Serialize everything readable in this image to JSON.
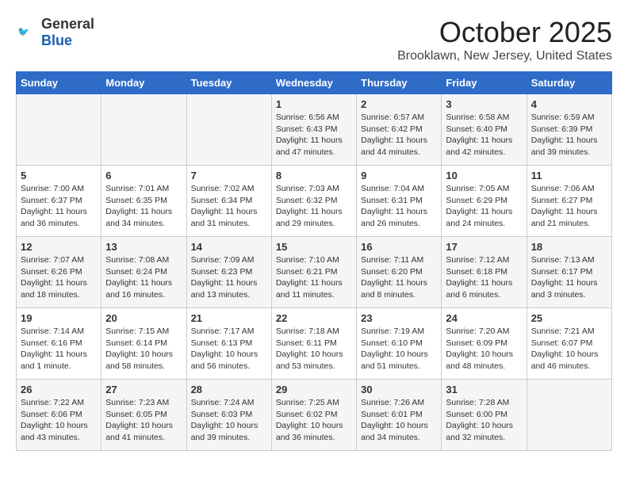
{
  "header": {
    "logo_general": "General",
    "logo_blue": "Blue",
    "month_title": "October 2025",
    "location": "Brooklawn, New Jersey, United States"
  },
  "days_of_week": [
    "Sunday",
    "Monday",
    "Tuesday",
    "Wednesday",
    "Thursday",
    "Friday",
    "Saturday"
  ],
  "weeks": [
    [
      {
        "day": "",
        "info": ""
      },
      {
        "day": "",
        "info": ""
      },
      {
        "day": "",
        "info": ""
      },
      {
        "day": "1",
        "info": "Sunrise: 6:56 AM\nSunset: 6:43 PM\nDaylight: 11 hours and 47 minutes."
      },
      {
        "day": "2",
        "info": "Sunrise: 6:57 AM\nSunset: 6:42 PM\nDaylight: 11 hours and 44 minutes."
      },
      {
        "day": "3",
        "info": "Sunrise: 6:58 AM\nSunset: 6:40 PM\nDaylight: 11 hours and 42 minutes."
      },
      {
        "day": "4",
        "info": "Sunrise: 6:59 AM\nSunset: 6:39 PM\nDaylight: 11 hours and 39 minutes."
      }
    ],
    [
      {
        "day": "5",
        "info": "Sunrise: 7:00 AM\nSunset: 6:37 PM\nDaylight: 11 hours and 36 minutes."
      },
      {
        "day": "6",
        "info": "Sunrise: 7:01 AM\nSunset: 6:35 PM\nDaylight: 11 hours and 34 minutes."
      },
      {
        "day": "7",
        "info": "Sunrise: 7:02 AM\nSunset: 6:34 PM\nDaylight: 11 hours and 31 minutes."
      },
      {
        "day": "8",
        "info": "Sunrise: 7:03 AM\nSunset: 6:32 PM\nDaylight: 11 hours and 29 minutes."
      },
      {
        "day": "9",
        "info": "Sunrise: 7:04 AM\nSunset: 6:31 PM\nDaylight: 11 hours and 26 minutes."
      },
      {
        "day": "10",
        "info": "Sunrise: 7:05 AM\nSunset: 6:29 PM\nDaylight: 11 hours and 24 minutes."
      },
      {
        "day": "11",
        "info": "Sunrise: 7:06 AM\nSunset: 6:27 PM\nDaylight: 11 hours and 21 minutes."
      }
    ],
    [
      {
        "day": "12",
        "info": "Sunrise: 7:07 AM\nSunset: 6:26 PM\nDaylight: 11 hours and 18 minutes."
      },
      {
        "day": "13",
        "info": "Sunrise: 7:08 AM\nSunset: 6:24 PM\nDaylight: 11 hours and 16 minutes."
      },
      {
        "day": "14",
        "info": "Sunrise: 7:09 AM\nSunset: 6:23 PM\nDaylight: 11 hours and 13 minutes."
      },
      {
        "day": "15",
        "info": "Sunrise: 7:10 AM\nSunset: 6:21 PM\nDaylight: 11 hours and 11 minutes."
      },
      {
        "day": "16",
        "info": "Sunrise: 7:11 AM\nSunset: 6:20 PM\nDaylight: 11 hours and 8 minutes."
      },
      {
        "day": "17",
        "info": "Sunrise: 7:12 AM\nSunset: 6:18 PM\nDaylight: 11 hours and 6 minutes."
      },
      {
        "day": "18",
        "info": "Sunrise: 7:13 AM\nSunset: 6:17 PM\nDaylight: 11 hours and 3 minutes."
      }
    ],
    [
      {
        "day": "19",
        "info": "Sunrise: 7:14 AM\nSunset: 6:16 PM\nDaylight: 11 hours and 1 minute."
      },
      {
        "day": "20",
        "info": "Sunrise: 7:15 AM\nSunset: 6:14 PM\nDaylight: 10 hours and 58 minutes."
      },
      {
        "day": "21",
        "info": "Sunrise: 7:17 AM\nSunset: 6:13 PM\nDaylight: 10 hours and 56 minutes."
      },
      {
        "day": "22",
        "info": "Sunrise: 7:18 AM\nSunset: 6:11 PM\nDaylight: 10 hours and 53 minutes."
      },
      {
        "day": "23",
        "info": "Sunrise: 7:19 AM\nSunset: 6:10 PM\nDaylight: 10 hours and 51 minutes."
      },
      {
        "day": "24",
        "info": "Sunrise: 7:20 AM\nSunset: 6:09 PM\nDaylight: 10 hours and 48 minutes."
      },
      {
        "day": "25",
        "info": "Sunrise: 7:21 AM\nSunset: 6:07 PM\nDaylight: 10 hours and 46 minutes."
      }
    ],
    [
      {
        "day": "26",
        "info": "Sunrise: 7:22 AM\nSunset: 6:06 PM\nDaylight: 10 hours and 43 minutes."
      },
      {
        "day": "27",
        "info": "Sunrise: 7:23 AM\nSunset: 6:05 PM\nDaylight: 10 hours and 41 minutes."
      },
      {
        "day": "28",
        "info": "Sunrise: 7:24 AM\nSunset: 6:03 PM\nDaylight: 10 hours and 39 minutes."
      },
      {
        "day": "29",
        "info": "Sunrise: 7:25 AM\nSunset: 6:02 PM\nDaylight: 10 hours and 36 minutes."
      },
      {
        "day": "30",
        "info": "Sunrise: 7:26 AM\nSunset: 6:01 PM\nDaylight: 10 hours and 34 minutes."
      },
      {
        "day": "31",
        "info": "Sunrise: 7:28 AM\nSunset: 6:00 PM\nDaylight: 10 hours and 32 minutes."
      },
      {
        "day": "",
        "info": ""
      }
    ]
  ]
}
